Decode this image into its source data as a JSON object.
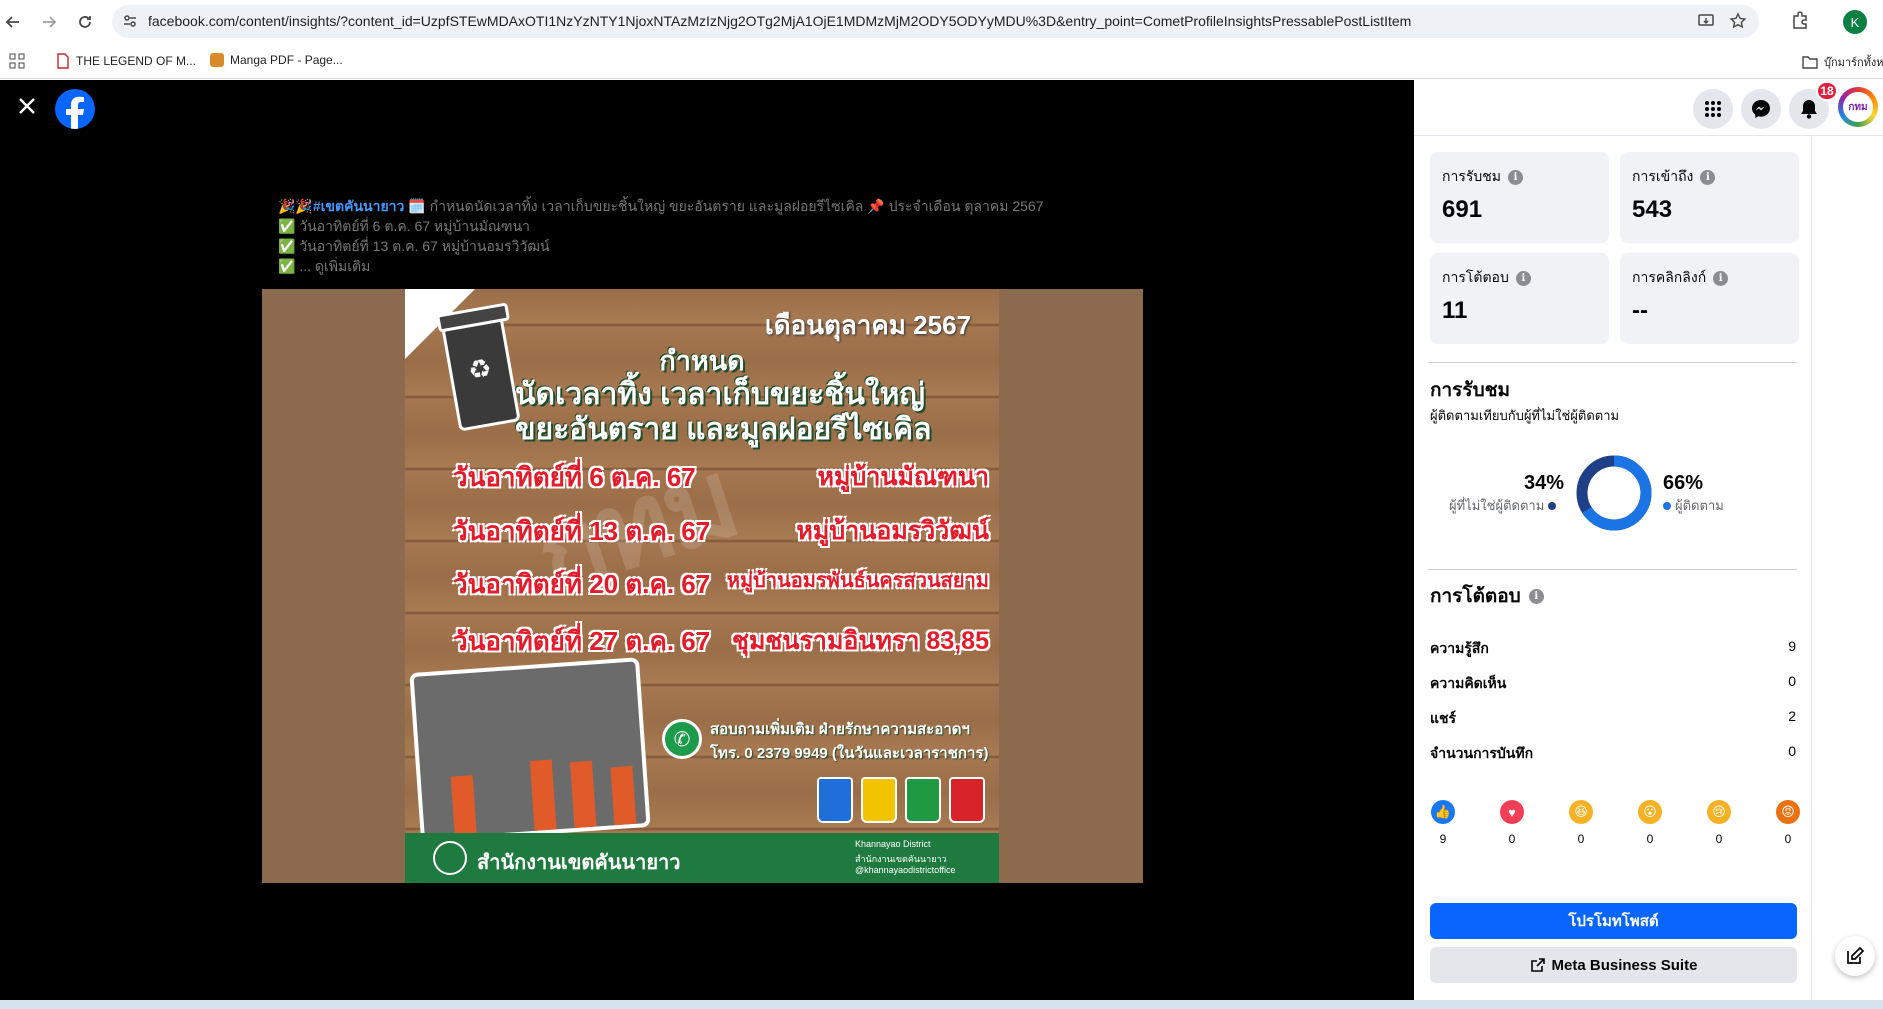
{
  "browser": {
    "url": "facebook.com/content/insights/?content_id=UzpfSTEwMDAxOTI1NzYzNTY1NjoxNTAzMzIzNjg2OTg2MjA1OjE1MDMzMjM2ODY5ODYyMDU%3D&entry_point=CometProfileInsightsPressablePostListItem",
    "profile_initial": "K",
    "bookmarks": [
      {
        "label": "THE LEGEND OF M..."
      },
      {
        "label": "Manga PDF - Page..."
      }
    ],
    "bookmarks_folder": "บุ๊กมาร์กทั้งหม"
  },
  "viewer": {
    "caption": {
      "hashtag": "🎉🎉#เขตคันนายาว",
      "line1_rest": " 🗓️ กำหนดนัดเวลาทิ้ง เวลาเก็บขยะชิ้นใหญ่ ขยะอันตราย และมูลฝอยรีไซเคิล 📌 ประจำเดือน ตุลาคม 2567",
      "line2": "✅ วันอาทิตย์ที่ 6 ต.ค. 67 หมู่บ้านมัณฑนา",
      "line3": "✅ วันอาทิตย์ที่ 13 ต.ค. 67 หมู่บ้านอมรวิวัฒน์",
      "line4": "✅ ... ดูเพิ่มเติม"
    },
    "poster": {
      "month": "เดือนตุลาคม 2567",
      "title1": "กำหนด",
      "title2": "นัดเวลาทิ้ง เวลาเก็บขยะชิ้นใหญ่",
      "title3": "ขยะอันตราย และมูลฝอยรีไซเคิล",
      "rows": [
        {
          "date": "วันอาทิตย์ที่ 6 ต.ค. 67",
          "venue": "หมู่บ้านมัณฑนา"
        },
        {
          "date": "วันอาทิตย์ที่ 13 ต.ค. 67",
          "venue": "หมู่บ้านอมรวิวัฒน์"
        },
        {
          "date": "วันอาทิตย์ที่ 20 ต.ค. 67",
          "venue": "หมู่บ้านอมรพันธ์นครสวนสยาม"
        },
        {
          "date": "วันอาทิตย์ที่ 27 ต.ค. 67",
          "venue": "ชุมชนรามอินทรา 83,85"
        }
      ],
      "contact1": "สอบถามเพิ่มเติม ฝ่ายรักษาความสะอาดฯ",
      "contact2": "โทร. 0 2379 9949 (ในวันและเวลาราชการ)",
      "office": "สำนักงานเขตคันนายาว",
      "social": [
        "Khannayao District",
        "สำนักงานเขตคันนายาว",
        "@khannayaodistrictoffice"
      ]
    }
  },
  "header": {
    "notification_count": "18",
    "avatar_text": "กทม"
  },
  "stats": [
    {
      "label": "การรับชม",
      "value": "691"
    },
    {
      "label": "การเข้าถึง",
      "value": "543"
    },
    {
      "label": "การโต้ตอบ",
      "value": "11"
    },
    {
      "label": "การคลิกลิงก์",
      "value": "--"
    }
  ],
  "views_section": {
    "title": "การรับชม",
    "subtitle": "ผู้ติดตามเทียบกับผู้ที่ไม่ใช่ผู้ติดตาม",
    "non_followers_pct": "34%",
    "non_followers_label": "ผู้ที่ไม่ใช่ผู้ติดตาม",
    "followers_pct": "66%",
    "followers_label": "ผู้ติดตาม",
    "followers_share": 0.66,
    "colors": {
      "followers": "#1b74e4",
      "non_followers": "#1f3f86"
    }
  },
  "engagement": {
    "title": "การโต้ตอบ",
    "metrics": [
      {
        "label": "ความรู้สึก",
        "value": "9"
      },
      {
        "label": "ความคิดเห็น",
        "value": "0"
      },
      {
        "label": "แชร์",
        "value": "2"
      },
      {
        "label": "จำนวนการบันทึก",
        "value": "0"
      }
    ],
    "reactions": [
      {
        "icon": "like-icon",
        "count": "9",
        "color": "#1877f2",
        "glyph": "👍"
      },
      {
        "icon": "love-icon",
        "count": "0",
        "color": "#f33e58",
        "glyph": "♥"
      },
      {
        "icon": "haha-icon",
        "count": "0",
        "color": "#f7b125",
        "glyph": "😆"
      },
      {
        "icon": "wow-icon",
        "count": "0",
        "color": "#f7b125",
        "glyph": "😮"
      },
      {
        "icon": "sad-icon",
        "count": "0",
        "color": "#f7b125",
        "glyph": "😢"
      },
      {
        "icon": "angry-icon",
        "count": "0",
        "color": "#e9710f",
        "glyph": "😡"
      }
    ]
  },
  "actions": {
    "promote": "โปรโมทโพสต์",
    "business_suite": "Meta Business Suite"
  }
}
